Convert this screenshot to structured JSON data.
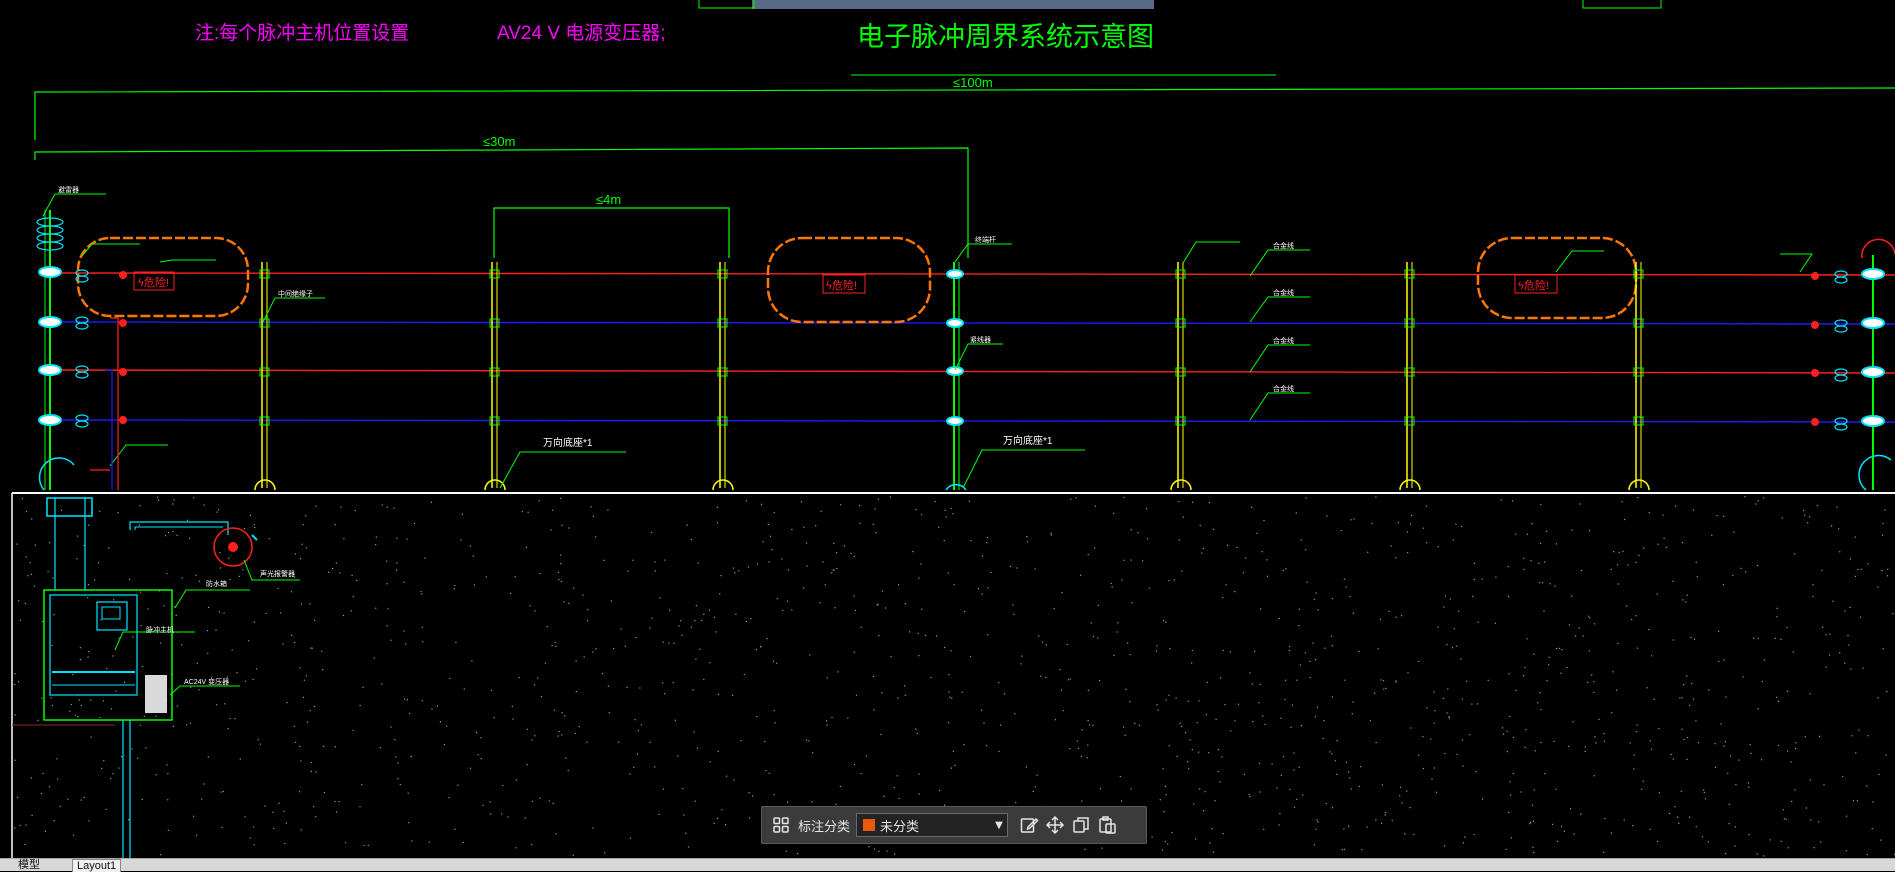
{
  "drawing": {
    "title": "电子脉冲周界系统示意图",
    "note": "注:每个脉冲主机位置设置",
    "transformer_note": "AV24 V 电源变压器;",
    "dim_total": "≤100m",
    "dim_segment": "≤30m",
    "dim_post": "≤4m",
    "warning_label": "ϟ危险!",
    "labels": {
      "corner_post_1": "万向底座*1",
      "corner_post_2": "万向底座*1",
      "mid_label_a": "终端杆",
      "mid_label_b": "中间绝缘子",
      "mid_label_c": "紧线器",
      "mid_label_d": "合金线",
      "small_top_left": "避雷器",
      "small_pulse_host": "脉冲主机",
      "small_ac": "AC24V 变压器",
      "small_alarm": "声光报警器",
      "small_box": "防水箱"
    },
    "colors": {
      "background": "#000000",
      "green_line": "#00ff00",
      "red_wire": "#ff2020",
      "blue_wire": "#1a1aff",
      "cyan": "#00e5ff",
      "yellow": "#ffff00",
      "orange": "#ff7700",
      "magenta": "#ff00ff"
    }
  },
  "toolbar": {
    "grid_icon": "grid-icon",
    "label": "标注分类",
    "select_value": "未分类",
    "select_swatch": "#e8590c",
    "icons": [
      "edit-icon",
      "move-icon",
      "copy-icon",
      "paste-icon"
    ]
  },
  "tabs": {
    "model": "模型",
    "layout1": "Layout1"
  }
}
